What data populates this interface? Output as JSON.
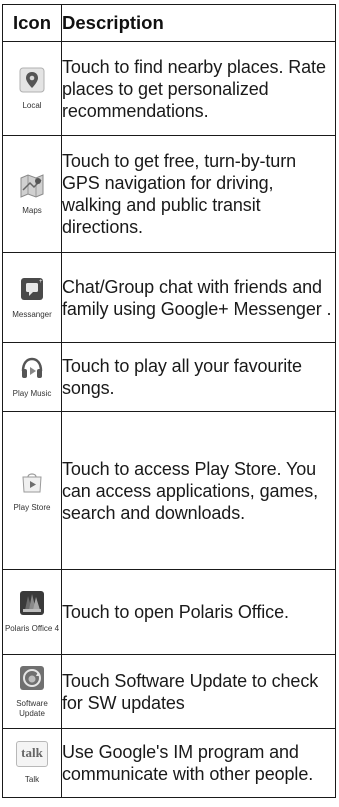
{
  "header": {
    "icon": "Icon",
    "description": "Description"
  },
  "rows": [
    {
      "icon": "map-pin-icon",
      "caption": "Local",
      "description": "Touch to find nearby places. Rate places to get personalized recommendations."
    },
    {
      "icon": "maps-icon",
      "caption": "Maps",
      "description": "Touch to get free, turn-by-turn GPS navigation for driving, walking and public transit directions."
    },
    {
      "icon": "messenger-icon",
      "caption": "Messanger",
      "description": "Chat/Group chat  with friends and family  using Google+ Messenger ."
    },
    {
      "icon": "headphones-icon",
      "caption": "Play Music",
      "description": "Touch to play all your favourite songs."
    },
    {
      "icon": "play-store-icon",
      "caption": "Play Store",
      "description": "Touch to access Play Store. You can access applications, games, search and downloads."
    },
    {
      "icon": "polaris-office-icon",
      "caption": "Polaris Office 4",
      "description": "Touch to open Polaris Office."
    },
    {
      "icon": "software-update-icon",
      "caption": "Software Update",
      "description": "Touch Software Update to check for SW updates"
    },
    {
      "icon": "talk-icon",
      "caption": "Talk",
      "icon_text": "talk",
      "description": "Use Google's IM program and communicate with other people."
    }
  ]
}
